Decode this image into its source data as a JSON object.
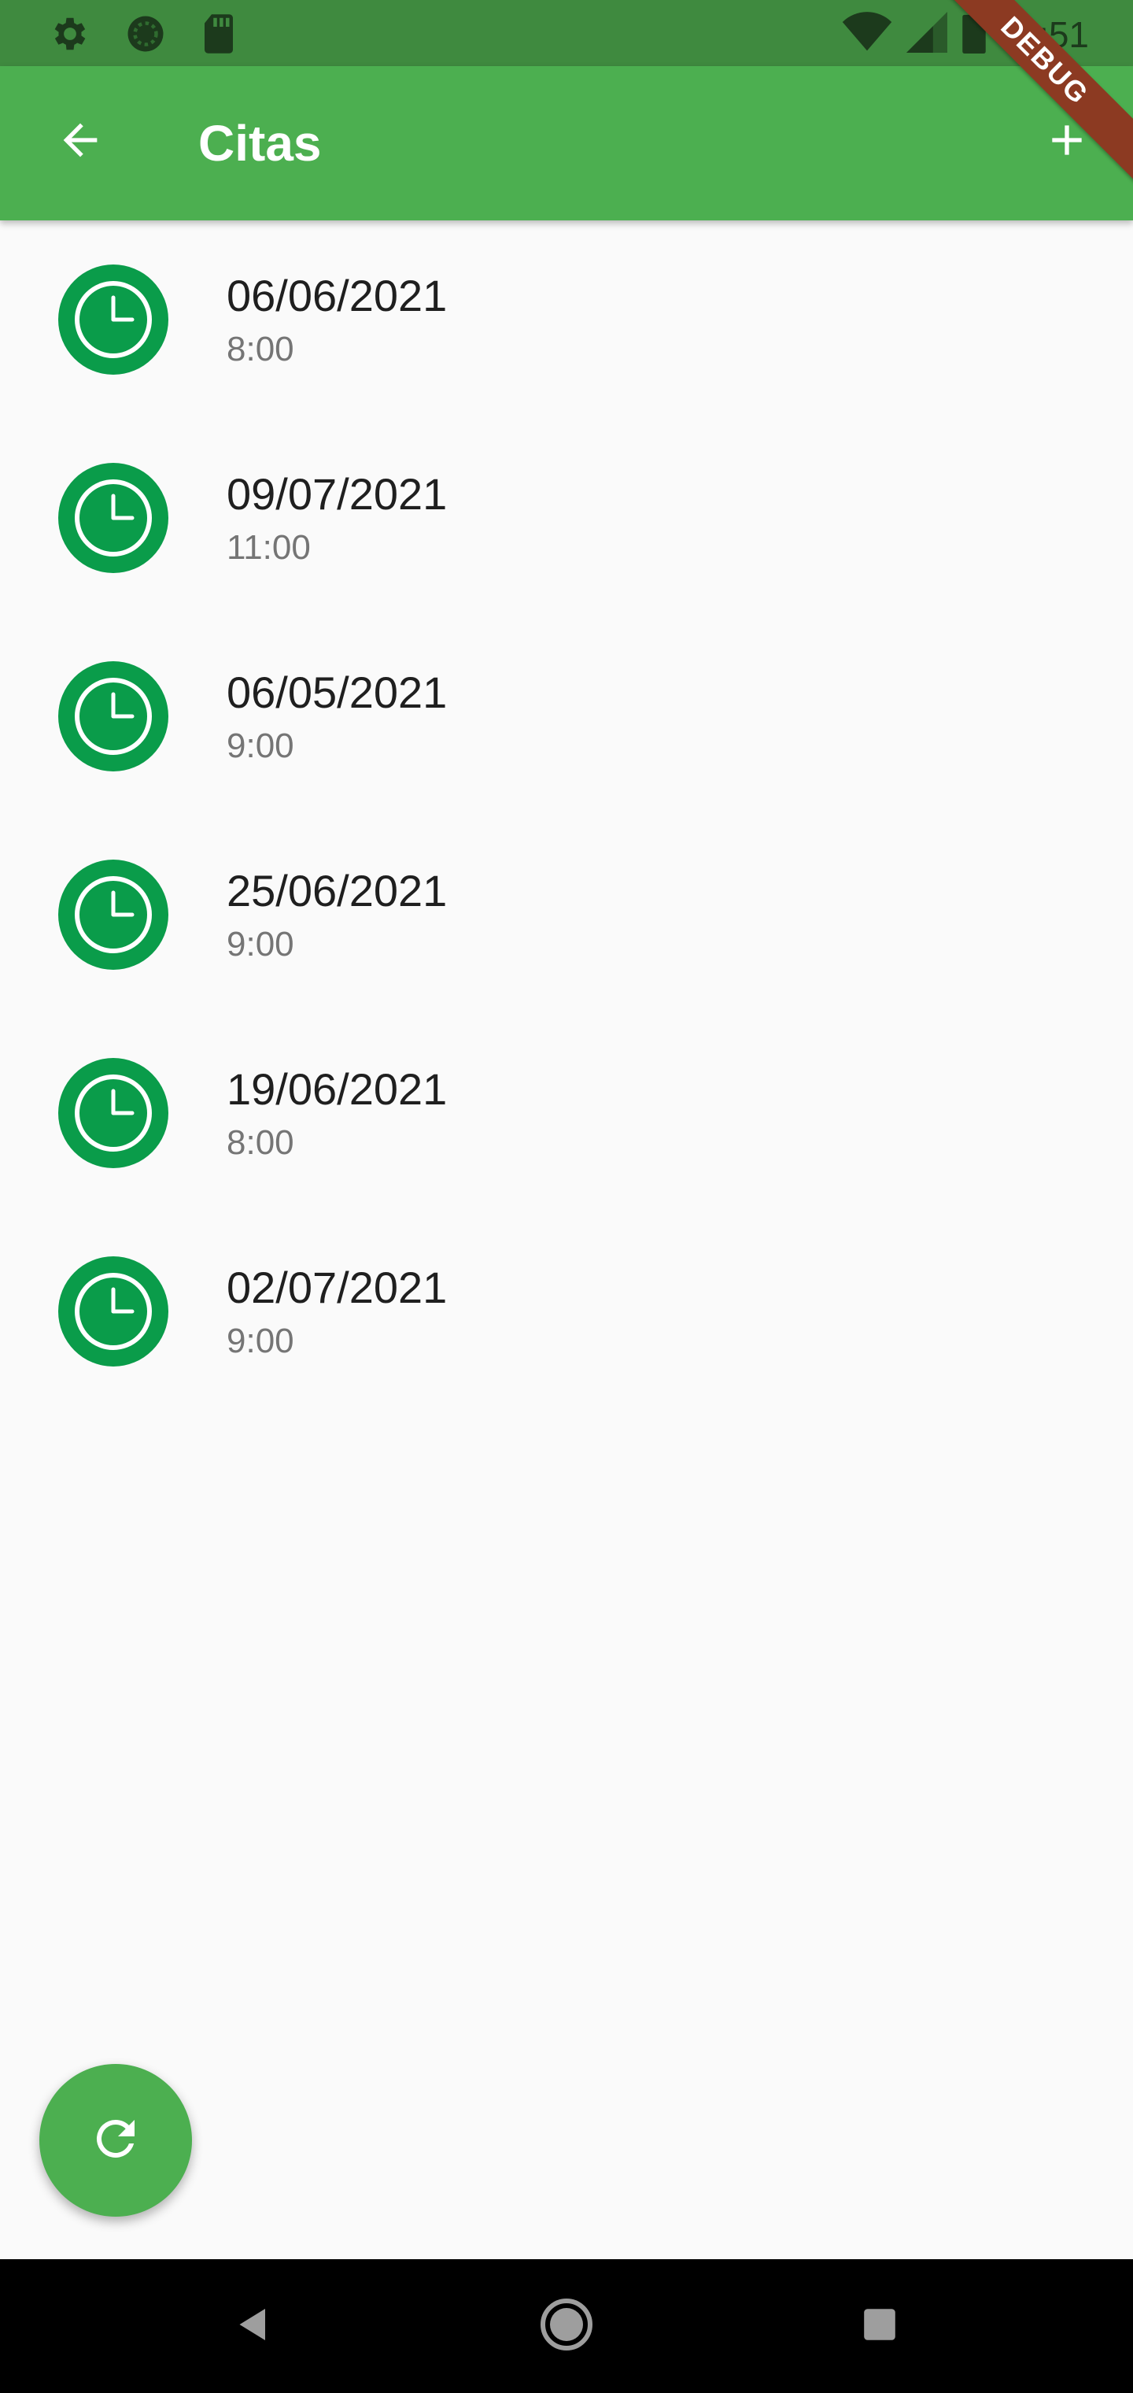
{
  "status_bar": {
    "time": "11:51",
    "icons_left": [
      "settings-icon",
      "sync-icon",
      "sd-card-icon"
    ],
    "icons_right": [
      "wifi-icon",
      "signal-icon",
      "battery-icon"
    ]
  },
  "app_bar": {
    "title": "Citas",
    "back_icon": "arrow-back-icon",
    "action_icon": "add-icon"
  },
  "debug_banner": "DEBUG",
  "appointments": [
    {
      "date": "06/06/2021",
      "time": "8:00"
    },
    {
      "date": "09/07/2021",
      "time": "11:00"
    },
    {
      "date": "06/05/2021",
      "time": "9:00"
    },
    {
      "date": "25/06/2021",
      "time": "9:00"
    },
    {
      "date": "19/06/2021",
      "time": "8:00"
    },
    {
      "date": "02/07/2021",
      "time": "9:00"
    }
  ],
  "fab": {
    "icon": "refresh-icon"
  },
  "nav_bar": {
    "icons": [
      "back-triangle-icon",
      "home-circle-icon",
      "recents-square-icon"
    ]
  },
  "colors": {
    "primary": "#4caf50",
    "status_bar": "#3f8a3f",
    "avatar": "#0a9c4a",
    "debug_ribbon": "#8c3a22",
    "background": "#fafafa"
  }
}
